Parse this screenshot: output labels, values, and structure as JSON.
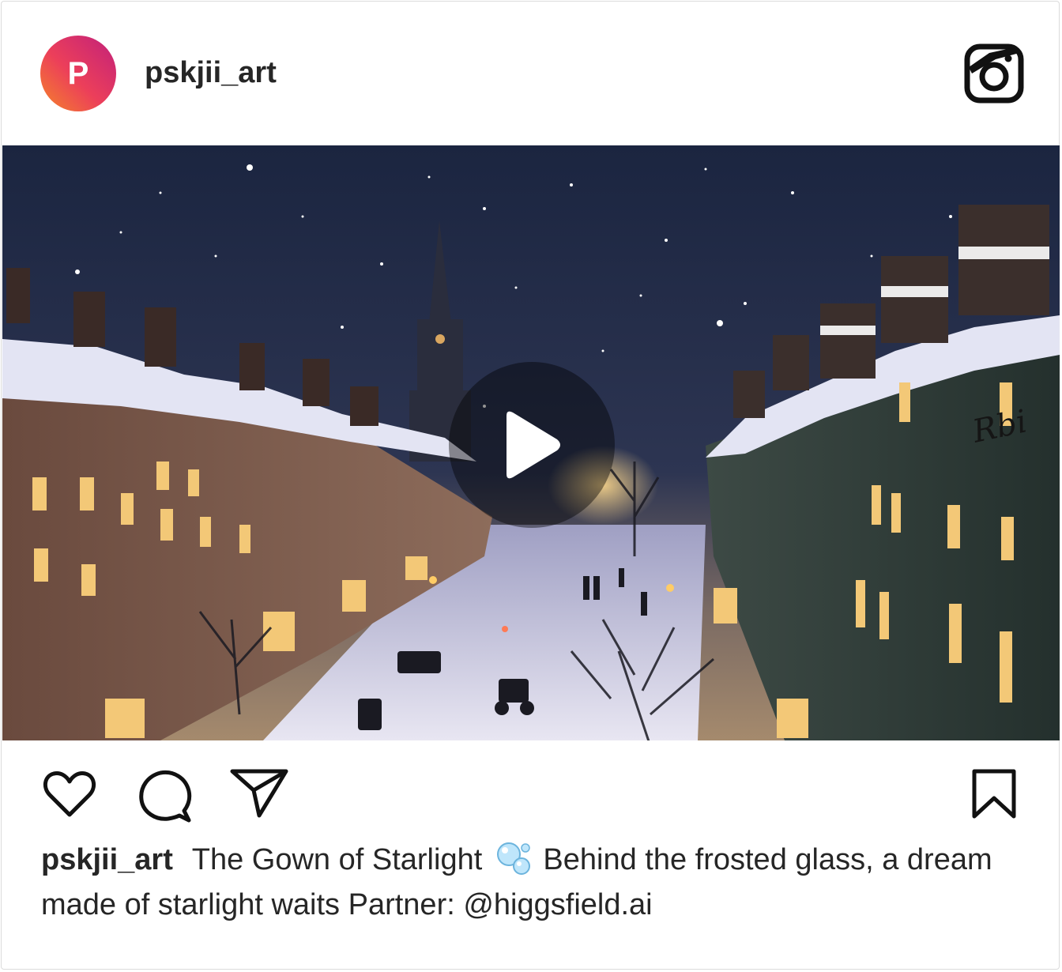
{
  "post": {
    "avatar_letter": "P",
    "username": "pskjii_art",
    "media": {
      "type": "video",
      "watermark": "Rbi"
    },
    "caption": {
      "username": "pskjii_art",
      "text_before_emoji": "The Gown of Starlight",
      "emoji": "bubbles-emoji",
      "text_after_emoji": "Behind the frosted glass, a dream made of starlight waits Partner: @higgsfield.ai"
    }
  },
  "icons": {
    "brand": "instagram-icon",
    "like": "heart-icon",
    "comment": "comment-icon",
    "share": "send-icon",
    "save": "bookmark-icon",
    "play": "play-icon"
  },
  "colors": {
    "text": "#262626",
    "border": "#dbdbdb",
    "avatar_gradient_start": "#f58529",
    "avatar_gradient_end": "#c1207b",
    "sky": "#1f2a44",
    "snow": "#d9dcef",
    "window_glow": "#f3c877"
  }
}
